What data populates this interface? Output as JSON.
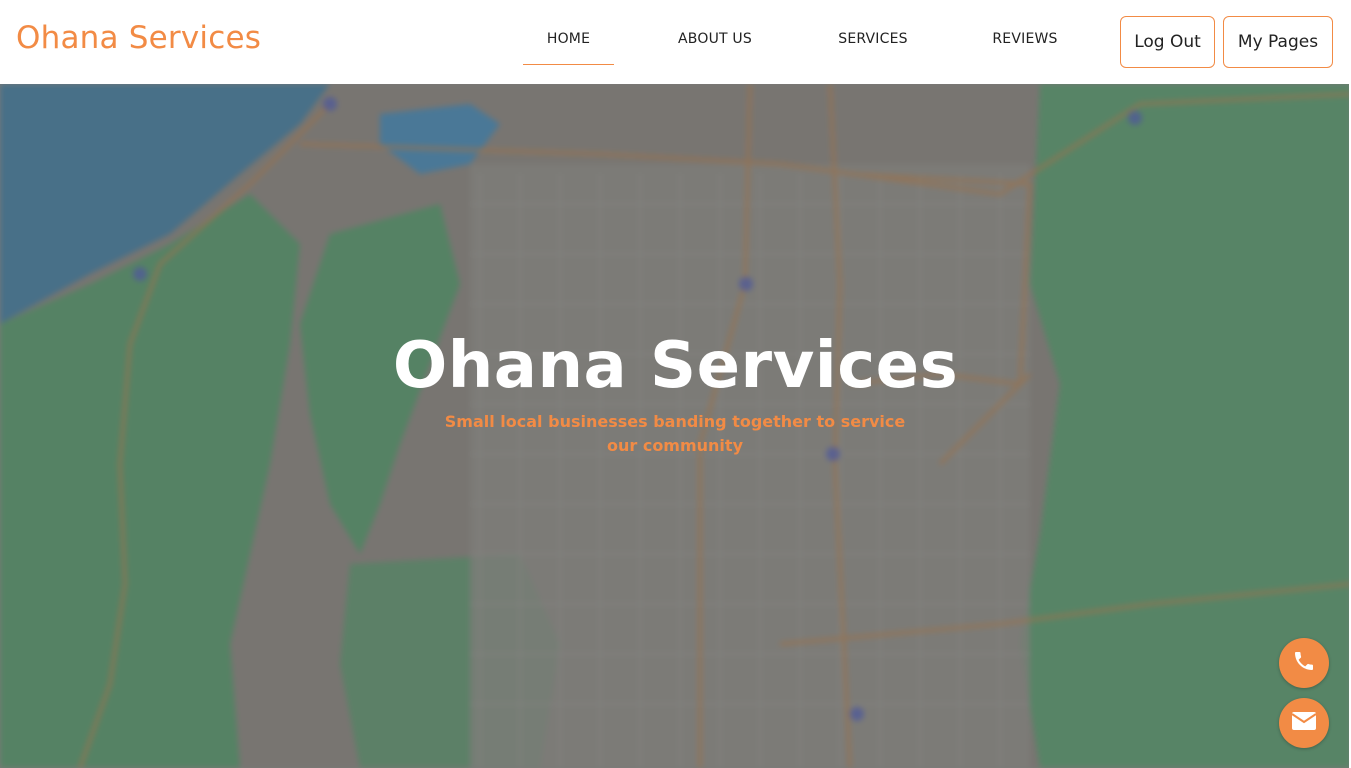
{
  "header": {
    "brand": "Ohana Services",
    "nav": [
      {
        "label": "HOME",
        "active": true
      },
      {
        "label": "ABOUT US",
        "active": false
      },
      {
        "label": "SERVICES",
        "active": false
      },
      {
        "label": "REVIEWS",
        "active": false
      }
    ],
    "buttons": {
      "logout": "Log Out",
      "my_pages": "My Pages"
    }
  },
  "hero": {
    "title": "Ohana Services",
    "subtitle": "Small local businesses banding together to service our community"
  },
  "floating_actions": {
    "phone_icon": "phone-icon",
    "email_icon": "envelope-icon"
  },
  "colors": {
    "accent": "#f28b45",
    "map_water": "#4a7a8f",
    "map_green": "#5a8a6a",
    "map_land": "#8a8680"
  }
}
